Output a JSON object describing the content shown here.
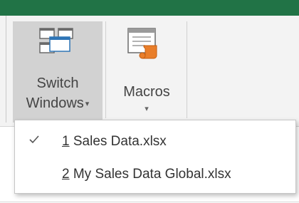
{
  "ribbon": {
    "switch_windows": {
      "label_line1": "Switch",
      "label_line2": "Windows",
      "dropdown_glyph": "▾",
      "icon": "switch-windows-icon"
    },
    "macros": {
      "label": "Macros",
      "dropdown_glyph": "▾",
      "icon": "macros-icon"
    }
  },
  "menu": {
    "items": [
      {
        "accelerator": "1",
        "name": " Sales Data.xlsx",
        "checked": true
      },
      {
        "accelerator": "2",
        "name": " My Sales Data Global.xlsx",
        "checked": false
      }
    ]
  },
  "colors": {
    "accent": "#217346",
    "pressed": "#d2d2d2",
    "ribbon_bg": "#f3f3f3",
    "icon_orange": "#e97e2a",
    "icon_blue": "#2e75b6"
  }
}
